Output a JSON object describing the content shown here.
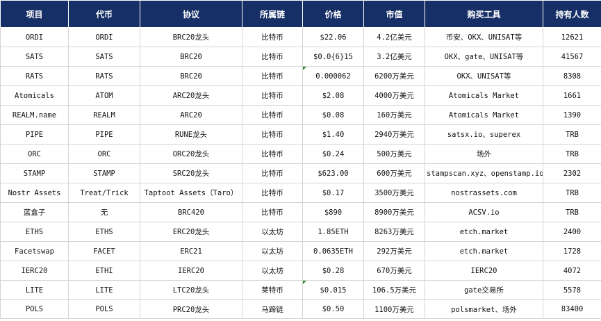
{
  "headers": [
    "项目",
    "代币",
    "协议",
    "所属链",
    "价格",
    "市值",
    "购买工具",
    "持有人数"
  ],
  "rows": [
    [
      "ORDI",
      "ORDI",
      "BRC20龙头",
      "比特币",
      "$22.06",
      "4.2亿美元",
      "币安、OKX、UNISAT等",
      "12621"
    ],
    [
      "SATS",
      "SATS",
      "BRC20",
      "比特币",
      "$0.0{6}15",
      "3.2亿美元",
      "OKX、gate、UNISAT等",
      "41567"
    ],
    [
      "RATS",
      "RATS",
      "BRC20",
      "比特币",
      "0.000062",
      "6200万美元",
      "OKX、UNISAT等",
      "8308"
    ],
    [
      "Atomicals",
      "ATOM",
      "ARC20龙头",
      "比特币",
      "$2.08",
      "4000万美元",
      "Atomicals Market",
      "1661"
    ],
    [
      "REALM.name",
      "REALM",
      "ARC20",
      "比特币",
      "$0.08",
      "160万美元",
      "Atomicals Market",
      "1390"
    ],
    [
      "PIPE",
      "PIPE",
      "RUNE龙头",
      "比特币",
      "$1.40",
      "2940万美元",
      "satsx.io、superex",
      "TRB"
    ],
    [
      "ORC",
      "ORC",
      "ORC20龙头",
      "比特币",
      "$0.24",
      "500万美元",
      "场外",
      "TRB"
    ],
    [
      "STAMP",
      "STAMP",
      "SRC20龙头",
      "比特币",
      "$623.00",
      "600万美元",
      "stampscan.xyz、openstamp.io",
      "2302"
    ],
    [
      "Nostr Assets",
      "Treat/Trick",
      "Taptoot Assets（Taro）",
      "比特币",
      "$0.17",
      "3500万美元",
      "nostrassets.com",
      "TRB"
    ],
    [
      "蓝盒子",
      "无",
      "BRC420",
      "比特币",
      "$890",
      "8900万美元",
      "ACSV.io",
      "TRB"
    ],
    [
      "ETHS",
      "ETHS",
      "ERC20龙头",
      "以太坊",
      "1.85ETH",
      "8263万美元",
      "etch.market",
      "2400"
    ],
    [
      "Facetswap",
      "FACET",
      "ERC21",
      "以太坊",
      "0.0635ETH",
      "292万美元",
      "etch.market",
      "1728"
    ],
    [
      "IERC20",
      "ETHI",
      "IERC20",
      "以太坊",
      "$0.28",
      "670万美元",
      "IERC20",
      "4072"
    ],
    [
      "LITE",
      "LITE",
      "LTC20龙头",
      "莱特币",
      "$0.015",
      "106.5万美元",
      "gate交易所",
      "5578"
    ],
    [
      "POLS",
      "POLS",
      "PRC20龙头",
      "马蹄链",
      "$0.50",
      "1100万美元",
      "polsmarket、场外",
      "83400"
    ]
  ]
}
